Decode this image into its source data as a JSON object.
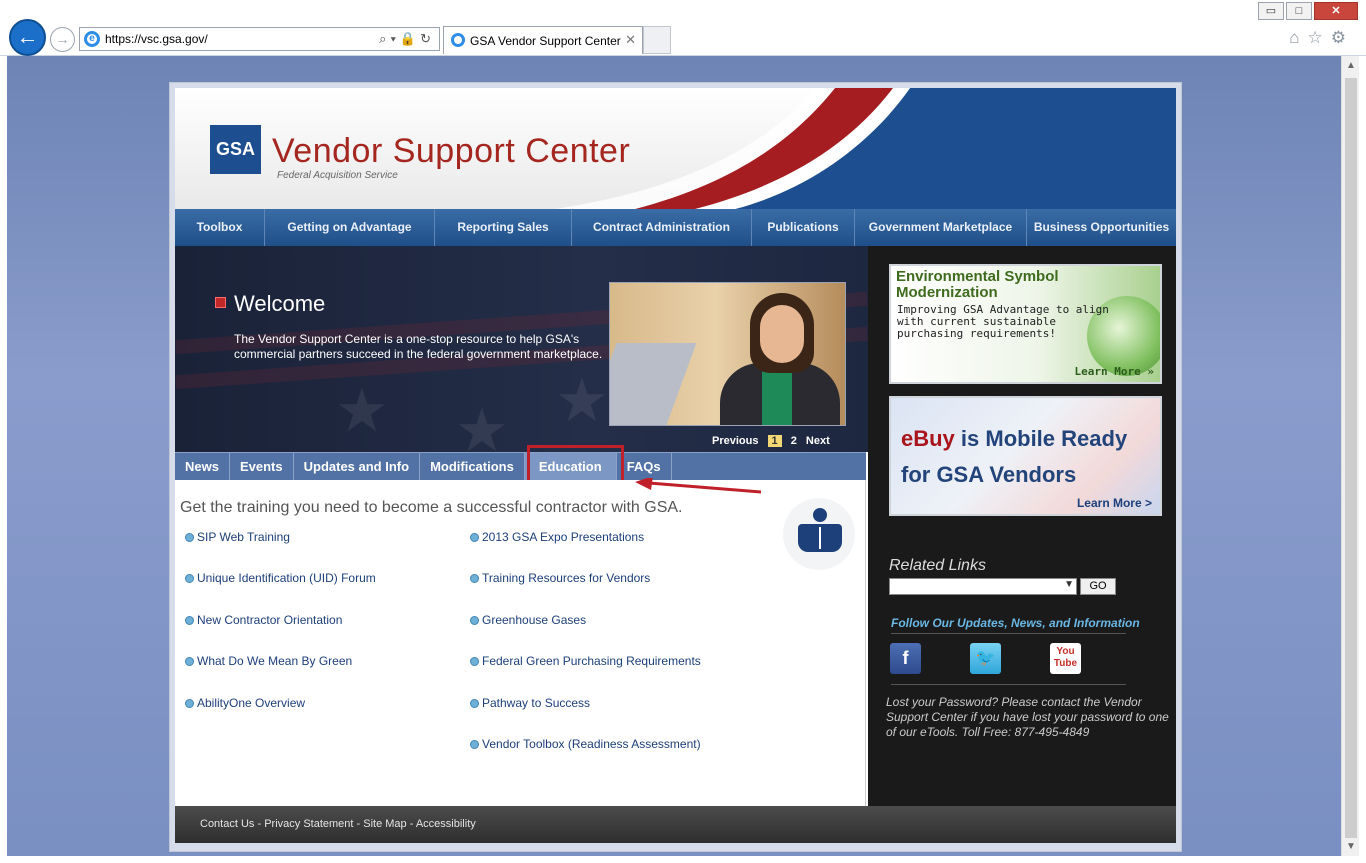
{
  "browser": {
    "url": "https://vsc.gsa.gov/",
    "tab_title": "GSA Vendor Support Center",
    "back_icon": "back-arrow-icon",
    "forward_icon": "forward-arrow-icon",
    "win_min": "▭",
    "win_max": "□",
    "win_close": "✕"
  },
  "header": {
    "logo_text": "GSA",
    "title": "Vendor Support Center",
    "subtitle": "Federal Acquisition Service"
  },
  "nav": {
    "items": [
      {
        "label": "Toolbox"
      },
      {
        "label": "Getting on Advantage"
      },
      {
        "label": "Reporting Sales"
      },
      {
        "label": "Contract Administration"
      },
      {
        "label": "Publications"
      },
      {
        "label": "Government Marketplace"
      },
      {
        "label": "Business Opportunities"
      }
    ]
  },
  "hero": {
    "title": "Welcome",
    "text": "The Vendor Support Center is a one-stop resource to help GSA's commercial partners succeed in the federal government marketplace.",
    "pager": {
      "previous": "Previous",
      "current": "1",
      "page2": "2",
      "next": "Next"
    }
  },
  "tabs": {
    "items": [
      {
        "label": "News"
      },
      {
        "label": "Events"
      },
      {
        "label": "Updates and Info"
      },
      {
        "label": "Modifications"
      },
      {
        "label": "Education",
        "active": true
      },
      {
        "label": "FAQs"
      }
    ]
  },
  "education": {
    "intro": "Get the training you need to become a successful contractor with GSA.",
    "left_links": [
      "SIP Web Training",
      "Unique Identification (UID) Forum",
      "New Contractor Orientation",
      "What Do We Mean By Green",
      "AbilityOne Overview"
    ],
    "right_links": [
      "2013 GSA Expo Presentations",
      "Training Resources for Vendors",
      "Greenhouse Gases",
      "Federal Green Purchasing Requirements",
      "Pathway to Success",
      "Vendor Toolbox (Readiness Assessment)"
    ]
  },
  "sidebar": {
    "ad1": {
      "title": "Environmental Symbol Modernization",
      "text": "Improving GSA Advantage to align with current sustainable purchasing requirements!",
      "more": "Learn More »"
    },
    "ad2": {
      "title_em": "eBuy",
      "title_rest": " is Mobile Ready",
      "title_line2": "for GSA Vendors",
      "more": "Learn More >"
    },
    "related_title": "Related Links",
    "go_label": "GO",
    "follow_text": "Follow Our Updates, News, and Information",
    "facebook_label": "f",
    "youtube_label": "You Tube",
    "lost_text": "Lost your Password? Please contact the Vendor Support Center if you have lost your password to one of our eTools. Toll Free: 877-495-4849"
  },
  "footer": {
    "links": [
      "Contact Us",
      "Privacy Statement",
      "Site Map",
      "Accessibility"
    ],
    "sep": " - "
  },
  "colors": {
    "brand_red": "#a4261f",
    "nav_blue": "#1f4f88",
    "tab_blue": "#5272a6",
    "highlight_red": "#c0202a",
    "sidebar_dark": "#1a1a1a"
  }
}
